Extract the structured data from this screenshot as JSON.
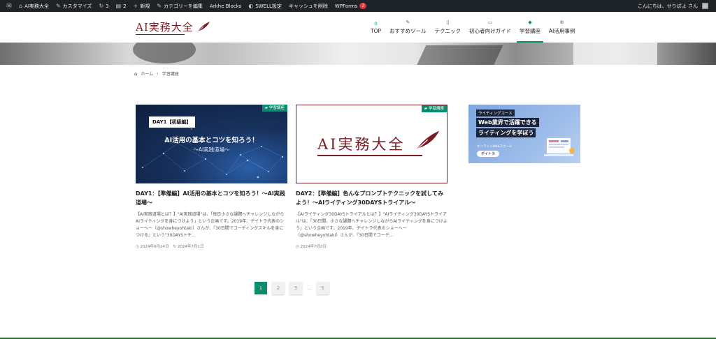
{
  "admin_bar": {
    "items": [
      {
        "icon": "wordpress-icon",
        "label": ""
      },
      {
        "icon": "home-icon",
        "label": "AI実務大全"
      },
      {
        "icon": "brush-icon",
        "label": "カスタマイズ"
      },
      {
        "icon": "refresh-icon",
        "label": "3"
      },
      {
        "icon": "comment-icon",
        "label": "2"
      },
      {
        "icon": "plus-icon",
        "label": "新規"
      },
      {
        "icon": "pencil-icon",
        "label": "カテゴリーを編集"
      },
      {
        "icon": "",
        "label": "Arkhe Blocks"
      },
      {
        "icon": "swell-icon",
        "label": "SWELL設定"
      },
      {
        "icon": "",
        "label": "キャッシュを削除"
      },
      {
        "icon": "",
        "label": "WPForms"
      }
    ],
    "wpforms_badge": "2",
    "greeting": "こんにちは、せりぽよ さん"
  },
  "header": {
    "logo_text": "AI実務大全",
    "nav": [
      {
        "icon": "home-icon",
        "label": "TOP"
      },
      {
        "icon": "star-icon",
        "label": "おすすめツール"
      },
      {
        "icon": "bookmark-icon",
        "label": "テクニック"
      },
      {
        "icon": "book-icon",
        "label": "初心者向けガイド"
      },
      {
        "icon": "graduation-cap-icon",
        "label": "学習講座"
      },
      {
        "icon": "search-icon",
        "label": "AI活用事例"
      }
    ]
  },
  "breadcrumb": {
    "home": "ホーム",
    "current": "学習講座"
  },
  "cards": [
    {
      "category": "学習講座",
      "thumb_tag": "DAY1【初級編】",
      "thumb_main": "AI活用の基本とコツを知ろう！",
      "thumb_sub": "〜AI実践道場〜",
      "title": "DAY1：【準備編】AI活用の基本とコツを知ろう！〜AI実践道場〜",
      "excerpt": "【AI実践道場とは？】\"AI実践道場\"は、「毎日小さな課題へチャレンジしながらAIライティングを身につけよう」という企画です。2019年、デイトラ代表のショーヘー（@showheyohtaki）さんが、『30日間でコーディングスキルを身につける』という\"30DAYSトチ...",
      "published": "2024年6月24日",
      "updated": "2024年7月1日"
    },
    {
      "category": "学習講座",
      "thumb_logo": "AI実務大全",
      "title": "DAY2：【準備編】色んなプロンプトテクニックを試してみよう！〜AIライティング30DAYSトライアル〜",
      "excerpt": "【AIライティング30DAYSトライアルとは？】\"AIライティング30DAYSトライアル\"は、「30日間、小さな課題へチャレンジしながらAIライティングを身につけよう」という企画です。2019年、デイトラ代表のショーヘー（@showheyohtaki）さんが、『30日間でコーデ...",
      "published": "2024年7月2日"
    }
  ],
  "banner": {
    "tag": "ライティングコース",
    "line1": "Web業界で活躍できる",
    "line2": "ライティングを学ぼう",
    "small": "オンラインWebスクール",
    "brand": "デイトラ"
  },
  "pagination": {
    "pages": [
      "1",
      "2",
      "3",
      "5"
    ],
    "dots": "…",
    "current": "1"
  },
  "colors": {
    "accent": "#0a8c6e",
    "brand": "#7a1c24",
    "admin_bar": "#1d2327"
  }
}
